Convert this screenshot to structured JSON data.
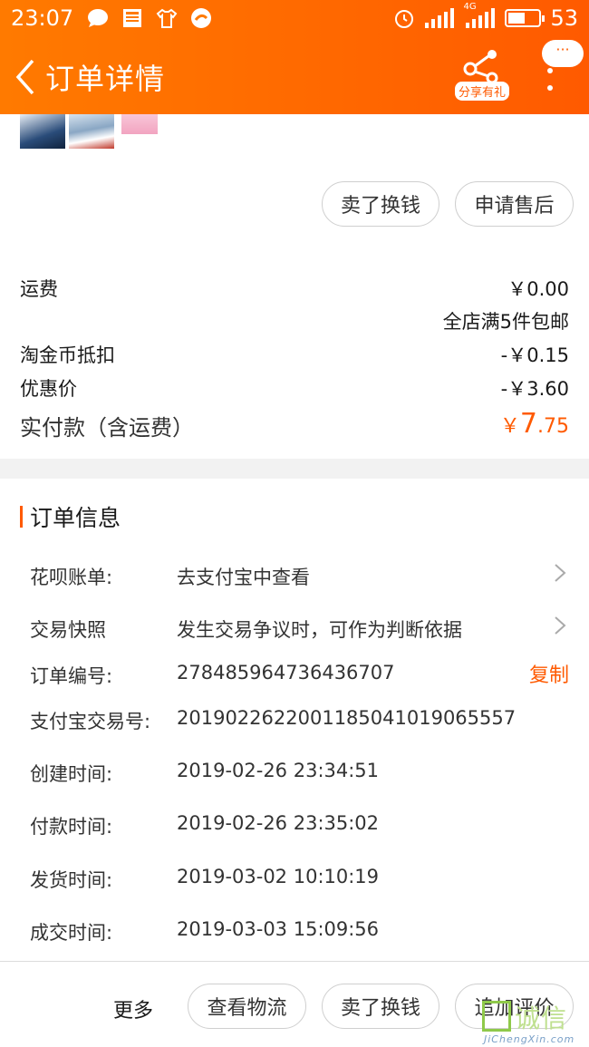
{
  "status_bar": {
    "time": "23:07",
    "icons_left": [
      "chat-bubble-icon",
      "news-icon",
      "tshirt-icon",
      "taobao-icon"
    ],
    "icons_right": [
      "alarm-icon",
      "signal-icon",
      "signal-4g-icon",
      "battery-icon"
    ],
    "signal_label": "4G",
    "battery": "53"
  },
  "nav": {
    "title": "订单详情",
    "share_label": "分享有礼",
    "bubble_label": "···"
  },
  "product_actions": {
    "sell_label": "卖了换钱",
    "after_sale_label": "申请售后"
  },
  "price_summary": {
    "shipping_label": "运费",
    "shipping_value": "￥0.00",
    "free_shipping_note": "全店满5件包邮",
    "coin_label": "淘金币抵扣",
    "coin_value": "-￥0.15",
    "discount_label": "优惠价",
    "discount_value": "-￥3.60",
    "total_label": "实付款（含运费）",
    "total_currency": "￥",
    "total_int": "7",
    "total_dec": ".75"
  },
  "order_info": {
    "title": "订单信息",
    "huabei_label": "花呗账单:",
    "huabei_value": "去支付宝中查看",
    "snapshot_label": "交易快照",
    "snapshot_value": "发生交易争议时，可作为判断依据",
    "order_no_label": "订单编号:",
    "order_no_value": "278485964736436707",
    "copy_label": "复制",
    "alipay_no_label": "支付宝交易号:",
    "alipay_no_value": "2019022622001185041019065557",
    "created_label": "创建时间:",
    "created_value": "2019-02-26 23:34:51",
    "paid_label": "付款时间:",
    "paid_value": "2019-02-26 23:35:02",
    "shipped_label": "发货时间:",
    "shipped_value": "2019-03-02 10:10:19",
    "closed_label": "成交时间:",
    "closed_value": "2019-03-03 15:09:56"
  },
  "footer": {
    "more_label": "更多",
    "logistics_label": "查看物流",
    "sell_label": "卖了换钱",
    "review_label": "追加评价"
  },
  "watermark": {
    "main": "诚信",
    "sub": "JiChengXin.com"
  },
  "colors": {
    "accent": "#ff5a00",
    "header_start": "#ff7a00",
    "divider": "#f2f2f2"
  }
}
